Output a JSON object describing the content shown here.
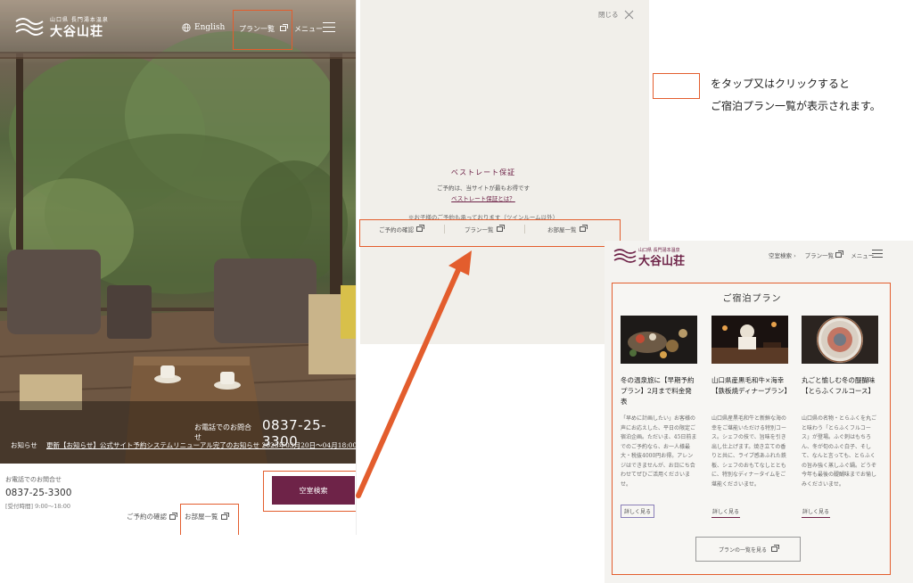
{
  "brand": {
    "tagline": "山口県 長門湯本温泉",
    "name": "大谷山荘"
  },
  "mobile_top": {
    "header": {
      "lang_label": "English",
      "plan_label": "プラン一覧",
      "menu_label": "メニュー"
    },
    "tel_overlay": {
      "label": "お電話でのお問合せ",
      "number": "0837-25-3300"
    },
    "news": {
      "label": "お知らせ",
      "text": "更新【お知らせ】公式サイト予約システムリニューアル完了のお知らせ 2023年03月20日～04月18:00"
    },
    "contact": {
      "label": "お電話でのお問合せ",
      "number": "0837-25-3300",
      "hours": "[受付時間] 9:00～18:00"
    },
    "vacancy_button": "空室検索",
    "footer_links": [
      "ご予約の確認",
      "お部屋一覧"
    ]
  },
  "menu_overlay": {
    "close_label": "閉じる",
    "best_rate_title": "ベストレート保証",
    "best_rate_desc": "ご予約は、当サイトが最もお得です",
    "best_rate_link": "ベストレート保証とは？",
    "note": "※お子様のご予約も承っております（ツインルーム以外）",
    "links": [
      "ご予約の確認",
      "プラン一覧",
      "お部屋一覧"
    ]
  },
  "explanation": {
    "line1": "をタップ又はクリックすると",
    "line2": "ご宿泊プラン一覧が表示されます。"
  },
  "plan_page": {
    "nav": [
      "空室検索 ›",
      "プラン一覧",
      "メニュー"
    ],
    "section_title": "ご宿泊プラン",
    "cards": [
      {
        "title": "冬の温泉旅に【早期予約プラン】2月まで料金発表",
        "desc": "「早めに計画したい」お客様の声にお応えした、平日の限定ご宿泊企画。ただいま、45日前までのご予約なら、お一人様最大・税抜4000円お得。アレンジはできませんが、お日にち合わせてぜひご活用くださいませ。",
        "more": "詳しく見る"
      },
      {
        "title": "山口県産黒毛和牛×海幸【鉄板焼ディナープラン】",
        "desc": "山口県産黒毛和牛と新鮮な海の幸をご堪能いただける特別コース。シェフの技で、旨味を引き出し仕上げます。焼き立ての香りと共に、ライブ感あふれた鉄板、シェフのおもてなしとともに、特別なディナータイムをご堪能くださいませ。",
        "more": "詳しく見る"
      },
      {
        "title": "丸ごと愉しむ冬の醍醐味【とらふくフルコース】",
        "desc": "山口県の名物・とらふくを丸ごと味わう「とらふくフルコース」が登場。ふぐ刺はもちろん、冬が旬のふぐ白子、そして、なんと言っても、とらふくの旨み強く蒸しふぐ鍋。どうぞ今年も最後の醍醐味までお愉しみくださいませ。",
        "more": "詳しく見る"
      }
    ],
    "all_button": "プランの一覧を見る"
  },
  "colors": {
    "accent": "#6e2348",
    "highlight": "#e35d2d"
  }
}
